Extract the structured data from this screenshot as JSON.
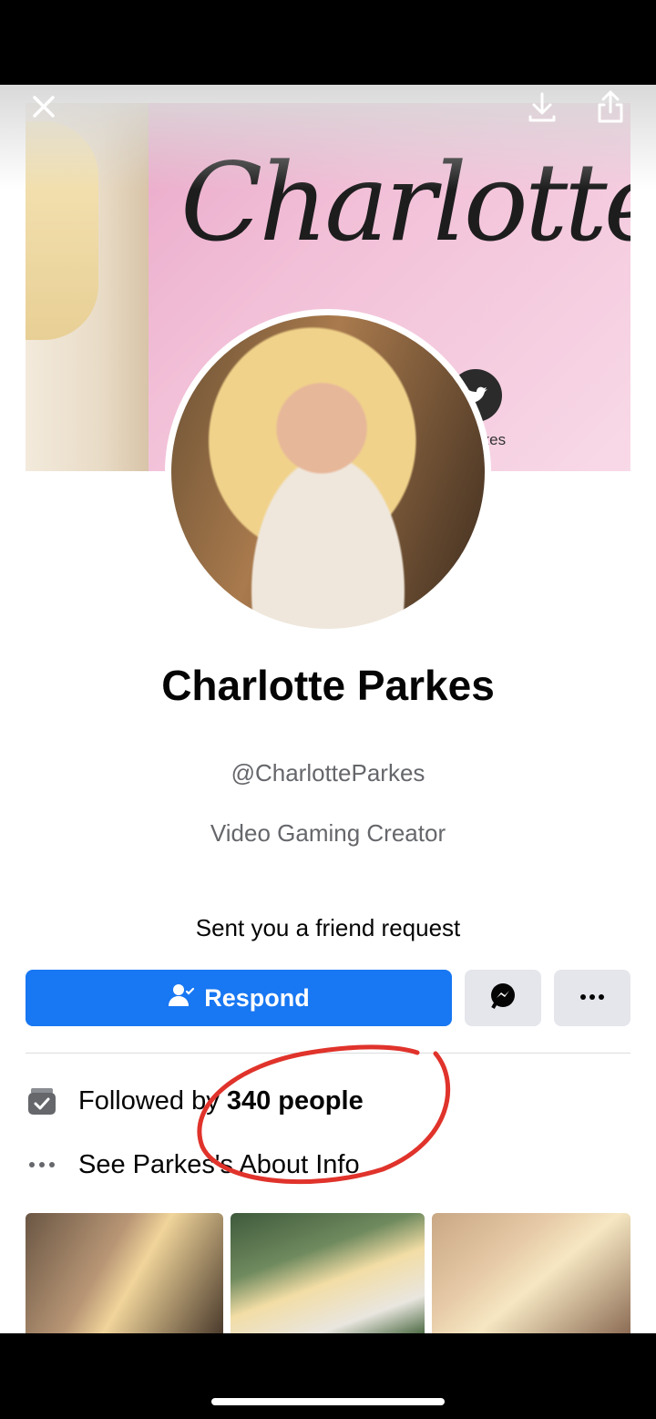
{
  "profile": {
    "name": "Charlotte Parkes",
    "handle": "@CharlotteParkes",
    "category": "Video Gaming Creator"
  },
  "cover": {
    "script_text": "Charlotte Pa",
    "handle_fragment": "rkes"
  },
  "friend_request": {
    "message": "Sent you a friend request",
    "respond_label": "Respond"
  },
  "info": {
    "followed_prefix": "Followed by ",
    "followed_count": "340 people",
    "about_link": "See Parkes's About Info"
  },
  "colors": {
    "accent": "#1877f2",
    "annotation": "#e0332b"
  },
  "icons": {
    "close": "close-icon",
    "download": "download-icon",
    "share": "share-icon",
    "messenger": "messenger-icon",
    "more": "more-icon",
    "followers": "followers-icon",
    "about": "ellipsis-icon"
  }
}
